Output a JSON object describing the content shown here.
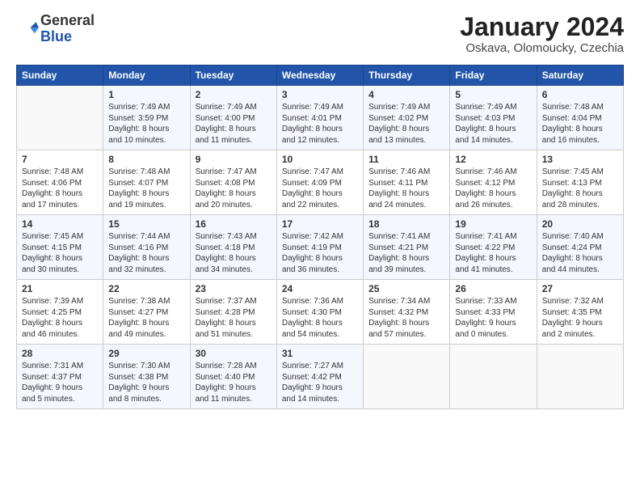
{
  "logo": {
    "general": "General",
    "blue": "Blue"
  },
  "header": {
    "month": "January 2024",
    "location": "Oskava, Olomoucky, Czechia"
  },
  "weekdays": [
    "Sunday",
    "Monday",
    "Tuesday",
    "Wednesday",
    "Thursday",
    "Friday",
    "Saturday"
  ],
  "weeks": [
    [
      {
        "day": "",
        "sunrise": "",
        "sunset": "",
        "daylight": ""
      },
      {
        "day": "1",
        "sunrise": "Sunrise: 7:49 AM",
        "sunset": "Sunset: 3:59 PM",
        "daylight": "Daylight: 8 hours and 10 minutes."
      },
      {
        "day": "2",
        "sunrise": "Sunrise: 7:49 AM",
        "sunset": "Sunset: 4:00 PM",
        "daylight": "Daylight: 8 hours and 11 minutes."
      },
      {
        "day": "3",
        "sunrise": "Sunrise: 7:49 AM",
        "sunset": "Sunset: 4:01 PM",
        "daylight": "Daylight: 8 hours and 12 minutes."
      },
      {
        "day": "4",
        "sunrise": "Sunrise: 7:49 AM",
        "sunset": "Sunset: 4:02 PM",
        "daylight": "Daylight: 8 hours and 13 minutes."
      },
      {
        "day": "5",
        "sunrise": "Sunrise: 7:49 AM",
        "sunset": "Sunset: 4:03 PM",
        "daylight": "Daylight: 8 hours and 14 minutes."
      },
      {
        "day": "6",
        "sunrise": "Sunrise: 7:48 AM",
        "sunset": "Sunset: 4:04 PM",
        "daylight": "Daylight: 8 hours and 16 minutes."
      }
    ],
    [
      {
        "day": "7",
        "sunrise": "Sunrise: 7:48 AM",
        "sunset": "Sunset: 4:06 PM",
        "daylight": "Daylight: 8 hours and 17 minutes."
      },
      {
        "day": "8",
        "sunrise": "Sunrise: 7:48 AM",
        "sunset": "Sunset: 4:07 PM",
        "daylight": "Daylight: 8 hours and 19 minutes."
      },
      {
        "day": "9",
        "sunrise": "Sunrise: 7:47 AM",
        "sunset": "Sunset: 4:08 PM",
        "daylight": "Daylight: 8 hours and 20 minutes."
      },
      {
        "day": "10",
        "sunrise": "Sunrise: 7:47 AM",
        "sunset": "Sunset: 4:09 PM",
        "daylight": "Daylight: 8 hours and 22 minutes."
      },
      {
        "day": "11",
        "sunrise": "Sunrise: 7:46 AM",
        "sunset": "Sunset: 4:11 PM",
        "daylight": "Daylight: 8 hours and 24 minutes."
      },
      {
        "day": "12",
        "sunrise": "Sunrise: 7:46 AM",
        "sunset": "Sunset: 4:12 PM",
        "daylight": "Daylight: 8 hours and 26 minutes."
      },
      {
        "day": "13",
        "sunrise": "Sunrise: 7:45 AM",
        "sunset": "Sunset: 4:13 PM",
        "daylight": "Daylight: 8 hours and 28 minutes."
      }
    ],
    [
      {
        "day": "14",
        "sunrise": "Sunrise: 7:45 AM",
        "sunset": "Sunset: 4:15 PM",
        "daylight": "Daylight: 8 hours and 30 minutes."
      },
      {
        "day": "15",
        "sunrise": "Sunrise: 7:44 AM",
        "sunset": "Sunset: 4:16 PM",
        "daylight": "Daylight: 8 hours and 32 minutes."
      },
      {
        "day": "16",
        "sunrise": "Sunrise: 7:43 AM",
        "sunset": "Sunset: 4:18 PM",
        "daylight": "Daylight: 8 hours and 34 minutes."
      },
      {
        "day": "17",
        "sunrise": "Sunrise: 7:42 AM",
        "sunset": "Sunset: 4:19 PM",
        "daylight": "Daylight: 8 hours and 36 minutes."
      },
      {
        "day": "18",
        "sunrise": "Sunrise: 7:41 AM",
        "sunset": "Sunset: 4:21 PM",
        "daylight": "Daylight: 8 hours and 39 minutes."
      },
      {
        "day": "19",
        "sunrise": "Sunrise: 7:41 AM",
        "sunset": "Sunset: 4:22 PM",
        "daylight": "Daylight: 8 hours and 41 minutes."
      },
      {
        "day": "20",
        "sunrise": "Sunrise: 7:40 AM",
        "sunset": "Sunset: 4:24 PM",
        "daylight": "Daylight: 8 hours and 44 minutes."
      }
    ],
    [
      {
        "day": "21",
        "sunrise": "Sunrise: 7:39 AM",
        "sunset": "Sunset: 4:25 PM",
        "daylight": "Daylight: 8 hours and 46 minutes."
      },
      {
        "day": "22",
        "sunrise": "Sunrise: 7:38 AM",
        "sunset": "Sunset: 4:27 PM",
        "daylight": "Daylight: 8 hours and 49 minutes."
      },
      {
        "day": "23",
        "sunrise": "Sunrise: 7:37 AM",
        "sunset": "Sunset: 4:28 PM",
        "daylight": "Daylight: 8 hours and 51 minutes."
      },
      {
        "day": "24",
        "sunrise": "Sunrise: 7:36 AM",
        "sunset": "Sunset: 4:30 PM",
        "daylight": "Daylight: 8 hours and 54 minutes."
      },
      {
        "day": "25",
        "sunrise": "Sunrise: 7:34 AM",
        "sunset": "Sunset: 4:32 PM",
        "daylight": "Daylight: 8 hours and 57 minutes."
      },
      {
        "day": "26",
        "sunrise": "Sunrise: 7:33 AM",
        "sunset": "Sunset: 4:33 PM",
        "daylight": "Daylight: 9 hours and 0 minutes."
      },
      {
        "day": "27",
        "sunrise": "Sunrise: 7:32 AM",
        "sunset": "Sunset: 4:35 PM",
        "daylight": "Daylight: 9 hours and 2 minutes."
      }
    ],
    [
      {
        "day": "28",
        "sunrise": "Sunrise: 7:31 AM",
        "sunset": "Sunset: 4:37 PM",
        "daylight": "Daylight: 9 hours and 5 minutes."
      },
      {
        "day": "29",
        "sunrise": "Sunrise: 7:30 AM",
        "sunset": "Sunset: 4:38 PM",
        "daylight": "Daylight: 9 hours and 8 minutes."
      },
      {
        "day": "30",
        "sunrise": "Sunrise: 7:28 AM",
        "sunset": "Sunset: 4:40 PM",
        "daylight": "Daylight: 9 hours and 11 minutes."
      },
      {
        "day": "31",
        "sunrise": "Sunrise: 7:27 AM",
        "sunset": "Sunset: 4:42 PM",
        "daylight": "Daylight: 9 hours and 14 minutes."
      },
      {
        "day": "",
        "sunrise": "",
        "sunset": "",
        "daylight": ""
      },
      {
        "day": "",
        "sunrise": "",
        "sunset": "",
        "daylight": ""
      },
      {
        "day": "",
        "sunrise": "",
        "sunset": "",
        "daylight": ""
      }
    ]
  ]
}
